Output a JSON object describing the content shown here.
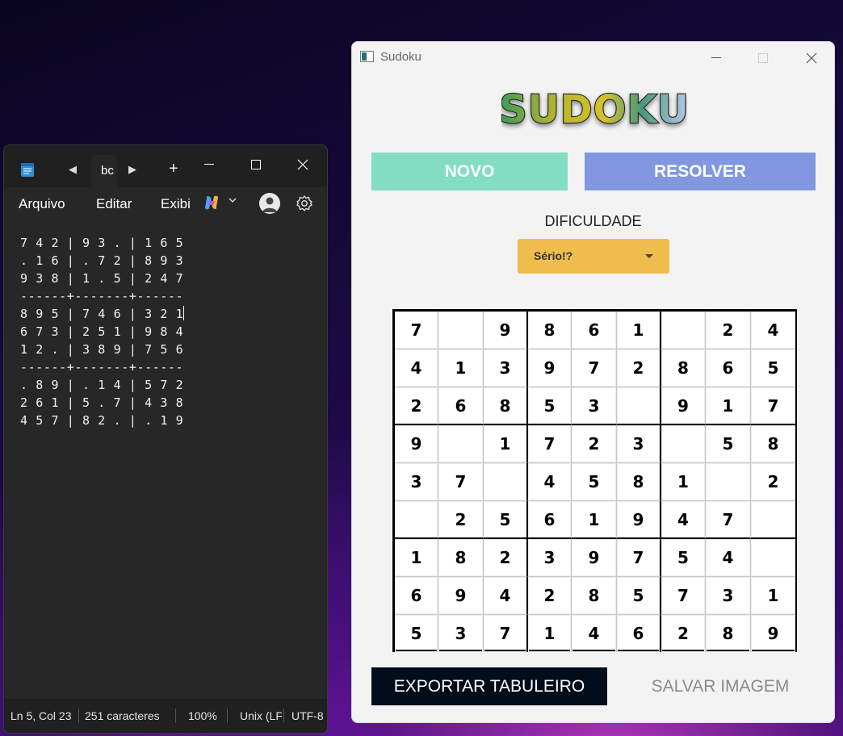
{
  "notepad": {
    "tab_label": "bc",
    "menu": {
      "file": "Arquivo",
      "edit": "Editar",
      "view": "Exibir"
    },
    "lines": [
      "7 4 2 | 9 3 . | 1 6 5",
      ". 1 6 | . 7 2 | 8 9 3",
      "9 3 8 | 1 . 5 | 2 4 7",
      "------+-------+------",
      "8 9 5 | 7 4 6 | 3 2 1",
      "6 7 3 | 2 5 1 | 9 8 4",
      "1 2 . | 3 8 9 | 7 5 6",
      "------+-------+------",
      ". 8 9 | . 1 4 | 5 7 2",
      "2 6 1 | 5 . 7 | 4 3 8",
      "4 5 7 | 8 2 . | . 1 9"
    ],
    "status": {
      "position": "Ln 5, Col 23",
      "characters": "251 caracteres",
      "zoom": "100%",
      "line_ending": "Unix (LF)",
      "encoding": "UTF-8"
    }
  },
  "sudoku": {
    "window_title": "Sudoku",
    "logo_text": "SUDOKU",
    "buttons": {
      "new": "NOVO",
      "solve": "RESOLVER",
      "export": "EXPORTAR TABULEIRO",
      "save_image": "SALVAR IMAGEM"
    },
    "difficulty": {
      "label": "DIFICULDADE",
      "selected": "Sério!?"
    },
    "grid": [
      [
        "7",
        "",
        "9",
        "8",
        "6",
        "1",
        "",
        "2",
        "4"
      ],
      [
        "4",
        "1",
        "3",
        "9",
        "7",
        "2",
        "8",
        "6",
        "5"
      ],
      [
        "2",
        "6",
        "8",
        "5",
        "3",
        "",
        "9",
        "1",
        "7"
      ],
      [
        "9",
        "",
        "1",
        "7",
        "2",
        "3",
        "",
        "5",
        "8"
      ],
      [
        "3",
        "7",
        "",
        "4",
        "5",
        "8",
        "1",
        "",
        "2"
      ],
      [
        "",
        "2",
        "5",
        "6",
        "1",
        "9",
        "4",
        "7",
        ""
      ],
      [
        "1",
        "8",
        "2",
        "3",
        "9",
        "7",
        "5",
        "4",
        ""
      ],
      [
        "6",
        "9",
        "4",
        "2",
        "8",
        "5",
        "7",
        "3",
        "1"
      ],
      [
        "5",
        "3",
        "7",
        "1",
        "4",
        "6",
        "2",
        "8",
        "9"
      ]
    ],
    "colors": {
      "new_button": "#82ddc2",
      "solve_button": "#8197e0",
      "difficulty_select": "#eebd4e",
      "export_button": "#020d1c"
    }
  }
}
